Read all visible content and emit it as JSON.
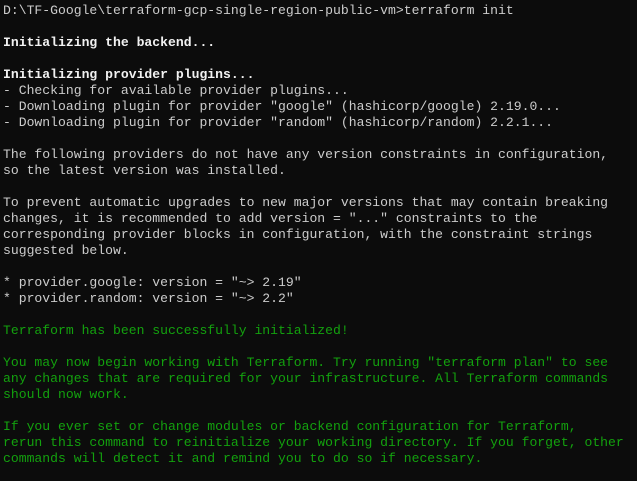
{
  "terminal": {
    "colors": {
      "background": "#0c0c0c",
      "text": "#cccccc",
      "bold": "#f2f2f2",
      "success": "#13a10e"
    },
    "lines": [
      {
        "text": "D:\\TF-Google\\terraform-gcp-single-region-public-vm>terraform init",
        "style": "normal"
      },
      {
        "text": "",
        "style": "blank"
      },
      {
        "text": "Initializing the backend...",
        "style": "bold"
      },
      {
        "text": "",
        "style": "blank"
      },
      {
        "text": "Initializing provider plugins...",
        "style": "bold"
      },
      {
        "text": "- Checking for available provider plugins...",
        "style": "normal"
      },
      {
        "text": "- Downloading plugin for provider \"google\" (hashicorp/google) 2.19.0...",
        "style": "normal"
      },
      {
        "text": "- Downloading plugin for provider \"random\" (hashicorp/random) 2.2.1...",
        "style": "normal"
      },
      {
        "text": "",
        "style": "blank"
      },
      {
        "text": "The following providers do not have any version constraints in configuration,",
        "style": "normal"
      },
      {
        "text": "so the latest version was installed.",
        "style": "normal"
      },
      {
        "text": "",
        "style": "blank"
      },
      {
        "text": "To prevent automatic upgrades to new major versions that may contain breaking",
        "style": "normal"
      },
      {
        "text": "changes, it is recommended to add version = \"...\" constraints to the",
        "style": "normal"
      },
      {
        "text": "corresponding provider blocks in configuration, with the constraint strings",
        "style": "normal"
      },
      {
        "text": "suggested below.",
        "style": "normal"
      },
      {
        "text": "",
        "style": "blank"
      },
      {
        "text": "* provider.google: version = \"~> 2.19\"",
        "style": "normal"
      },
      {
        "text": "* provider.random: version = \"~> 2.2\"",
        "style": "normal"
      },
      {
        "text": "",
        "style": "blank"
      },
      {
        "text": "Terraform has been successfully initialized!",
        "style": "green"
      },
      {
        "text": "",
        "style": "blank"
      },
      {
        "text": "You may now begin working with Terraform. Try running \"terraform plan\" to see",
        "style": "green"
      },
      {
        "text": "any changes that are required for your infrastructure. All Terraform commands",
        "style": "green"
      },
      {
        "text": "should now work.",
        "style": "green"
      },
      {
        "text": "",
        "style": "blank"
      },
      {
        "text": "If you ever set or change modules or backend configuration for Terraform,",
        "style": "green"
      },
      {
        "text": "rerun this command to reinitialize your working directory. If you forget, other",
        "style": "green"
      },
      {
        "text": "commands will detect it and remind you to do so if necessary.",
        "style": "green"
      }
    ]
  }
}
